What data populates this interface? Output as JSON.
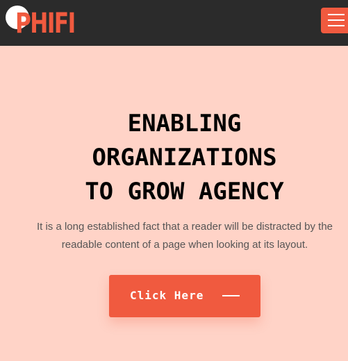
{
  "colors": {
    "accent": "#F05A3F",
    "navbar": "#2B2B2B",
    "background": "#FFD3C7"
  },
  "brand": {
    "name": "PHIFI"
  },
  "menu": {
    "icon": "hamburger-icon"
  },
  "hero": {
    "headline_lines": [
      "ENABLING",
      "ORGANIZATIONS",
      "TO GROW AGENCY"
    ],
    "description": "It is a long established fact that a reader will be distracted by the readable content of a page when looking at its layout.",
    "cta_label": "Click Here",
    "cta_icon": "dash-arrow-icon"
  }
}
